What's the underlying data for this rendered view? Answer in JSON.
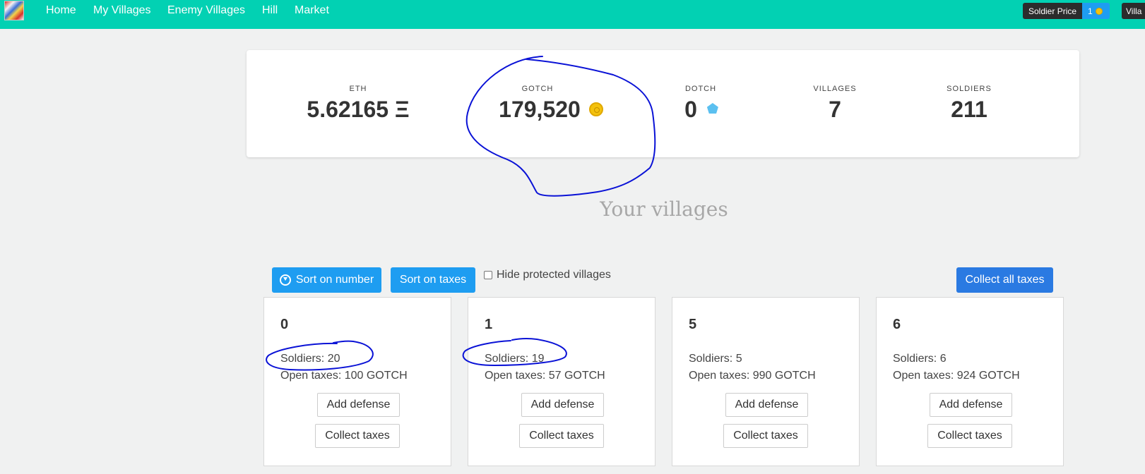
{
  "nav": {
    "links": [
      {
        "label": "Home"
      },
      {
        "label": "My Villages"
      },
      {
        "label": "Enemy Villages"
      },
      {
        "label": "Hill"
      },
      {
        "label": "Market"
      }
    ],
    "soldier_price_label": "Soldier Price",
    "soldier_price_value": "1",
    "villages_pill_label": "Villa"
  },
  "stats": {
    "eth": {
      "label": "ETH",
      "value": "5.62165 Ξ"
    },
    "gotch": {
      "label": "GOTCH",
      "value": "179,520"
    },
    "dotch": {
      "label": "DOTCH",
      "value": "0"
    },
    "villages": {
      "label": "VILLAGES",
      "value": "7"
    },
    "soldiers": {
      "label": "SOLDIERS",
      "value": "211"
    }
  },
  "section_title": "Your villages",
  "toolbar": {
    "sort_number": "Sort on number",
    "sort_taxes": "Sort on taxes",
    "hide_protected": "Hide protected villages",
    "collect_all": "Collect all taxes"
  },
  "villages": [
    {
      "number": "0",
      "soldiers": "Soldiers: 20",
      "taxes": "Open taxes: 100 GOTCH",
      "defense_label": "Add defense",
      "collect_label": "Collect taxes"
    },
    {
      "number": "1",
      "soldiers": "Soldiers: 19",
      "taxes": "Open taxes: 57 GOTCH",
      "defense_label": "Add defense",
      "collect_label": "Collect taxes"
    },
    {
      "number": "5",
      "soldiers": "Soldiers: 5",
      "taxes": "Open taxes: 990 GOTCH",
      "defense_label": "Add defense",
      "collect_label": "Collect taxes"
    },
    {
      "number": "6",
      "soldiers": "Soldiers: 6",
      "taxes": "Open taxes: 924 GOTCH",
      "defense_label": "Add defense",
      "collect_label": "Collect taxes"
    }
  ],
  "colors": {
    "navbar": "#02d1b3",
    "primary_button": "#1e9df1",
    "collect_all_button": "#2a7ae2",
    "annotation_ink": "#0a12d6"
  }
}
